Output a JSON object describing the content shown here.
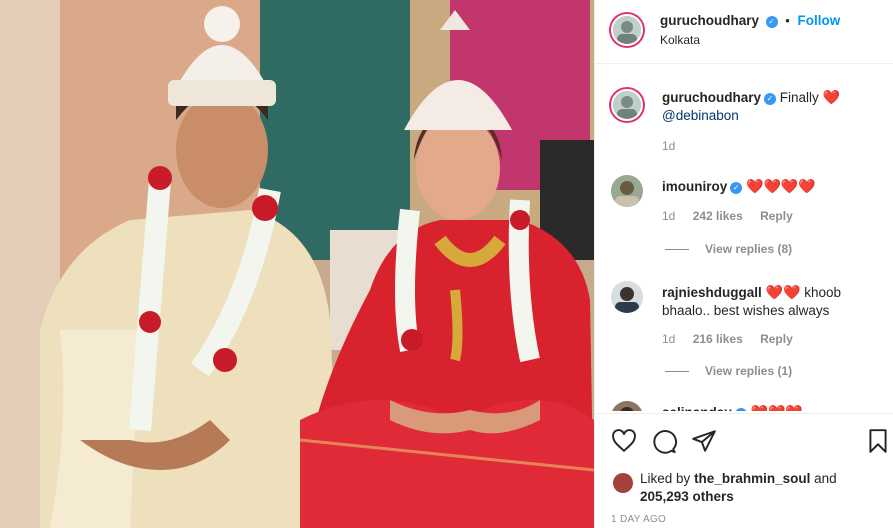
{
  "post": {
    "author": "guruchoudhary",
    "follow_label": "Follow",
    "location": "Kolkata"
  },
  "caption": {
    "username": "guruchoudhary",
    "text": "Finally",
    "mention": "@debinabon",
    "time": "1d"
  },
  "comments": [
    {
      "username": "imouniroy",
      "text": "",
      "hearts": "❤️❤️❤️❤️",
      "time": "1d",
      "likes": "242 likes",
      "reply_label": "Reply",
      "view_replies": "View replies (8)"
    },
    {
      "username": "rajnieshduggall",
      "text": "khoob bhaalo.. best wishes always",
      "hearts": "❤️❤️",
      "time": "1d",
      "likes": "216 likes",
      "reply_label": "Reply",
      "view_replies": "View replies (1)"
    },
    {
      "username": "selinanday",
      "hearts": "❤️❤️❤️"
    }
  ],
  "likes": {
    "prefix": "Liked by",
    "user": "the_brahmin_soul",
    "connector": "and",
    "count": "205,293 others"
  },
  "timestamp": "1 DAY AGO",
  "colors": {
    "accent": "#0095f6",
    "verified": "#3897f0",
    "heart": "#ed1c24",
    "muted": "#8e8e8e"
  },
  "icons": {
    "like": "heart-outline-icon",
    "comment": "comment-bubble-icon",
    "share": "paper-plane-icon"
  }
}
